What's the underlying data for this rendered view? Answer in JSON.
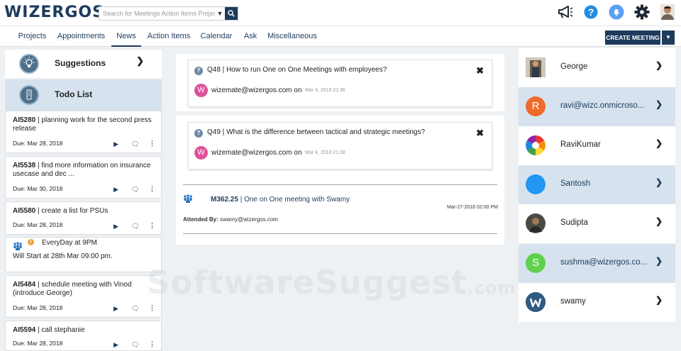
{
  "header": {
    "logo_text": "WIZERGOS",
    "search_placeholder": "Search for Meetings Action Items Projects",
    "icons": [
      "megaphone-icon",
      "help-icon",
      "notification-icon",
      "settings-icon",
      "user-avatar"
    ]
  },
  "nav": {
    "tabs": [
      "Projects",
      "Appointments",
      "News",
      "Action Items",
      "Calendar",
      "Ask",
      "Miscellaneous"
    ],
    "active_tab": "News",
    "create_meeting_label": "CREATE MEETING"
  },
  "sidebar": {
    "suggestions_label": "Suggestions",
    "todo_label": "Todo List",
    "todos": [
      {
        "id": "AI5280",
        "text": "planning work for the second press release",
        "due": "Due: Mar 28, 2018"
      },
      {
        "id": "AI5538",
        "text": "find more information on insurance usecase and dec ...",
        "due": "Due: Mar 30, 2018"
      },
      {
        "id": "AI5580",
        "text": "create a list for PSUs",
        "due": "Due: Mar 28, 2018"
      },
      {
        "id": "AI5484",
        "text": "schedule meeting with Vinod (introduce George)",
        "due": "Due: Mar 28, 2018"
      },
      {
        "id": "AI5594",
        "text": "call stephanie",
        "due": "Due: Mar 28, 2018"
      }
    ],
    "recurring": {
      "schedule": "EveryDay at 9PM",
      "start": "Will Start at 28th Mar 09:00 pm."
    }
  },
  "feed": {
    "questions": [
      {
        "id": "Q48",
        "text": "How to run One on One Meetings with employees?",
        "user": "wizemate@wizergos.com on",
        "time": "Mar 4, 2018 21:36",
        "avatar_letter": "W"
      },
      {
        "id": "Q49",
        "text": "What is the difference between tactical and strategic meetings?",
        "user": "wizemate@wizergos.com on",
        "time": "Mar 4, 2018 21:38",
        "avatar_letter": "W"
      }
    ],
    "meeting": {
      "id": "M362.25",
      "title": "One on One meeting with Swamy",
      "date": "Mar-27-2018 02:00 PM",
      "attended_label": "Attended By:",
      "attendee": "swamy@wizergos.com"
    }
  },
  "people": [
    {
      "name": "George",
      "avatar": "photo",
      "bg": "#6b5a4a",
      "letter": ""
    },
    {
      "name": "ravi@wizc.onmicroso...",
      "avatar": "letter",
      "bg": "#f06a2a",
      "letter": "R"
    },
    {
      "name": "RaviKumar",
      "avatar": "pinwheel",
      "bg": "#ffffff",
      "letter": ""
    },
    {
      "name": "Santosh",
      "avatar": "letter",
      "bg": "#2196f3",
      "letter": ""
    },
    {
      "name": "Sudipta",
      "avatar": "photo",
      "bg": "#4a4a42",
      "letter": ""
    },
    {
      "name": "sushma@wizergos.co...",
      "avatar": "letter",
      "bg": "#5fd14c",
      "letter": "S"
    },
    {
      "name": "swamy",
      "avatar": "logo",
      "bg": "#2f5b80",
      "letter": "W"
    }
  ],
  "watermark": {
    "main": "SoftwareSuggest",
    "suffix": ".com"
  }
}
